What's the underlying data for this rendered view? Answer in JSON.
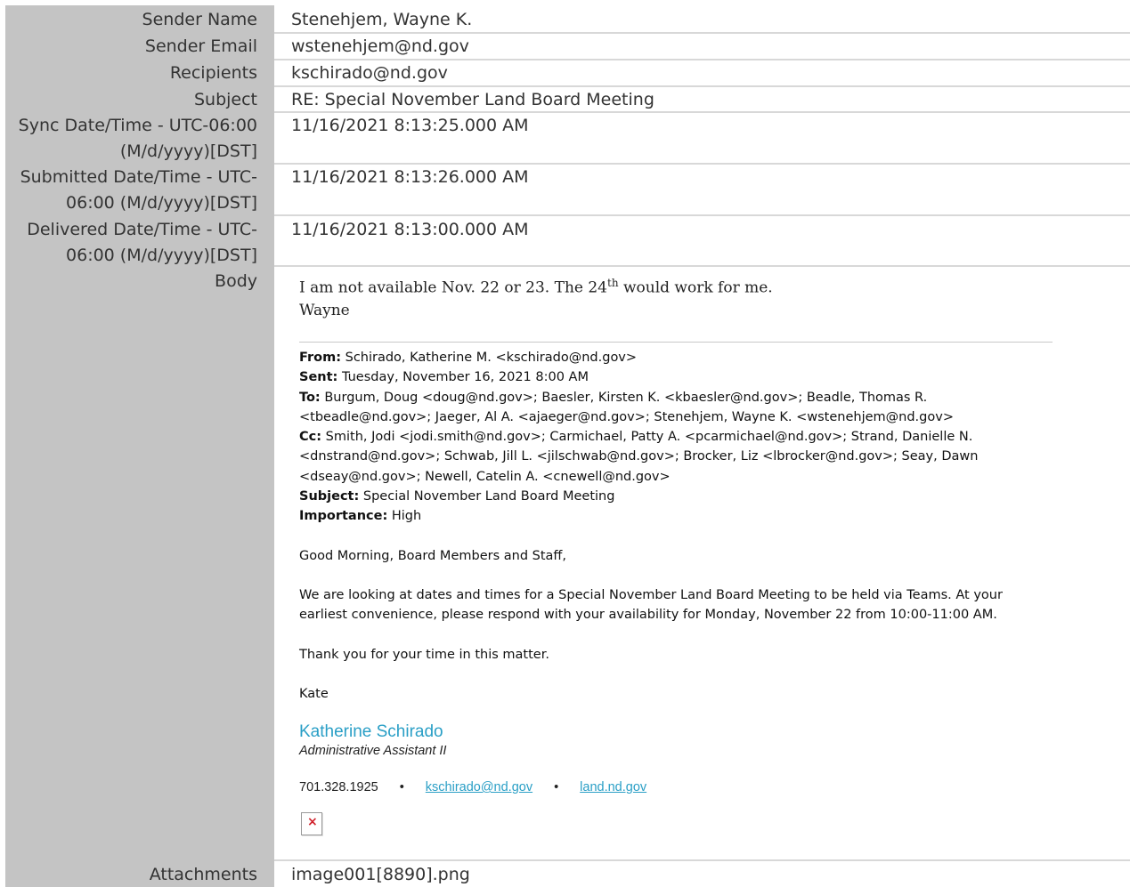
{
  "fields": [
    {
      "label": "Sender Name",
      "value": "Stenehjem, Wayne K."
    },
    {
      "label": "Sender Email",
      "value": "wstenehjem@nd.gov"
    },
    {
      "label": "Recipients",
      "value": "kschirado@nd.gov"
    },
    {
      "label": "Subject",
      "value": "RE: Special November Land Board Meeting"
    },
    {
      "label_line1": "Sync Date/Time - UTC-06:00",
      "label_line2": "(M/d/yyyy)[DST]",
      "value": "11/16/2021 8:13:25.000 AM"
    },
    {
      "label_line1": "Submitted Date/Time - UTC-",
      "label_line2": "06:00 (M/d/yyyy)[DST]",
      "value": "11/16/2021 8:13:26.000 AM"
    },
    {
      "label_line1": "Delivered Date/Time - UTC-",
      "label_line2": "06:00 (M/d/yyyy)[DST]",
      "value": "11/16/2021 8:13:00.000 AM"
    },
    {
      "label": "Body"
    },
    {
      "label": "Attachments",
      "value": "image001[8890].png"
    }
  ],
  "body": {
    "reply_line1_pre": "I am not available Nov. 22 or 23.  The 24",
    "reply_line1_sup": "th",
    "reply_line1_post": " would work for me.",
    "reply_line2": "Wayne",
    "header": {
      "from_label": "From:",
      "from": "Schirado, Katherine M. <kschirado@nd.gov>",
      "sent_label": "Sent:",
      "sent": "Tuesday, November 16, 2021 8:00 AM",
      "to_label": "To:",
      "to_line1": "Burgum, Doug <doug@nd.gov>; Baesler, Kirsten K. <kbaesler@nd.gov>; Beadle, Thomas R.",
      "to_line2": "<tbeadle@nd.gov>; Jaeger, Al A. <ajaeger@nd.gov>; Stenehjem, Wayne K. <wstenehjem@nd.gov>",
      "cc_label": "Cc:",
      "cc_line1": "Smith, Jodi <jodi.smith@nd.gov>; Carmichael, Patty A. <pcarmichael@nd.gov>; Strand, Danielle N.",
      "cc_line2": "<dnstrand@nd.gov>; Schwab, Jill L. <jilschwab@nd.gov>; Brocker, Liz <lbrocker@nd.gov>; Seay, Dawn",
      "cc_line3": "<dseay@nd.gov>; Newell, Catelin A. <cnewell@nd.gov>",
      "subject_label": "Subject:",
      "subject": "Special November Land Board Meeting",
      "importance_label": "Importance:",
      "importance": "High"
    },
    "greeting": "Good Morning, Board Members and Staff,",
    "para1_line1": "We are looking at dates and times for a Special November Land Board Meeting to be held via Teams. At your",
    "para1_line2": "earliest convenience, please respond with your availability for Monday, November 22 from 10:00-11:00 AM.",
    "thanks": "Thank you for your time in this matter.",
    "signoff": "Kate",
    "sig_name": "Katherine Schirado",
    "sig_title": "Administrative Assistant II",
    "sig_phone": "701.328.1925",
    "sig_bullet": "•",
    "sig_email": "kschirado@nd.gov",
    "sig_site": "land.nd.gov",
    "broken_image_icon": "broken-image-icon"
  }
}
